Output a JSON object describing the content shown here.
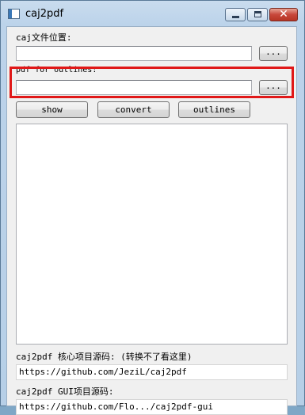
{
  "window": {
    "title": "caj2pdf",
    "minimize_icon": "minimize-icon",
    "maximize_icon": "maximize-icon",
    "close_icon": "close-icon",
    "close_glyph": "✕"
  },
  "caj_section": {
    "label": "caj文件位置:",
    "path_value": "",
    "browse_label": "..."
  },
  "outline_section": {
    "label": "pdf for outlines:",
    "path_value": "",
    "browse_label": "...",
    "highlight_color": "#e01818"
  },
  "actions": {
    "show_label": "show",
    "convert_label": "convert",
    "outlines_label": "outlines"
  },
  "output_log": "",
  "links": {
    "core_label": "caj2pdf 核心项目源码: (转换不了看这里)",
    "core_url": "https://github.com/JeziL/caj2pdf",
    "gui_label": "caj2pdf GUI项目源码:",
    "gui_url": "https://github.com/Flo.../caj2pdf-gui"
  }
}
